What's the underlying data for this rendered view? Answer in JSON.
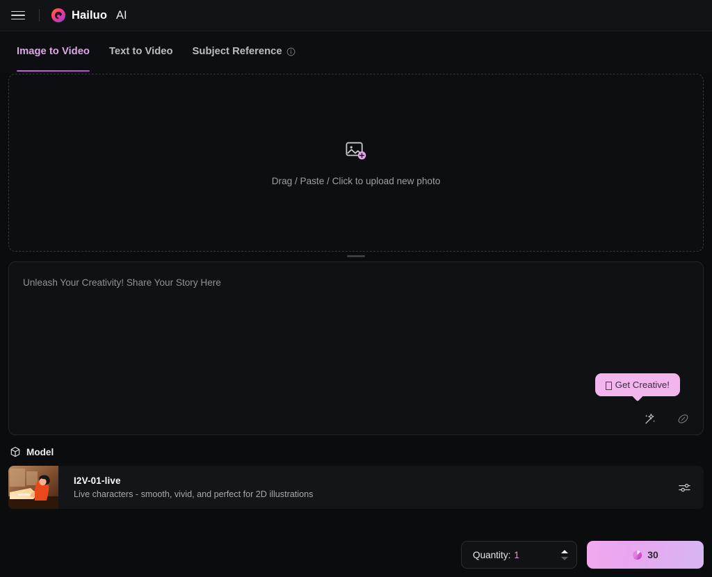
{
  "header": {
    "menu_icon": "hamburger-icon",
    "logo_icon": "hailuo-spiral-logo",
    "brand_name": "Hailuo",
    "brand_suffix": "AI"
  },
  "tabs": [
    {
      "label": "Image to Video",
      "active": true,
      "info": false
    },
    {
      "label": "Text to Video",
      "active": false,
      "info": false
    },
    {
      "label": "Subject Reference",
      "active": false,
      "info": true,
      "info_icon": "info-circle-icon"
    }
  ],
  "upload": {
    "icon": "image-add-icon",
    "text": "Drag / Paste / Click to upload new photo"
  },
  "resize_handle": {
    "name": "panel-resize-handle"
  },
  "prompt": {
    "placeholder": "Unleash Your Creativity! Share Your Story Here",
    "value": "",
    "tooltip_text": "Get Creative!",
    "tooltip_glyph": "missing-glyph-box",
    "tools": [
      {
        "name": "magic-wand-icon",
        "title": "Get Creative!"
      },
      {
        "name": "eraser-icon",
        "title": "Clear"
      }
    ]
  },
  "model_section": {
    "icon": "cube-icon",
    "label": "Model",
    "card": {
      "thumbnail": "artist-drawing-illustration",
      "name": "I2V-01-live",
      "description": "Live characters - smooth, vivid, and perfect for 2D illustrations",
      "settings_icon": "sliders-icon"
    }
  },
  "footer": {
    "quantity_label": "Quantity:",
    "quantity_value": "1",
    "stepper_up": "caret-up-icon",
    "stepper_down": "caret-down-icon",
    "generate_credits": "30",
    "credit_icon": "credit-orb-icon"
  },
  "colors": {
    "page_bg": "#0b0c0e",
    "header_bg": "#121316",
    "accent_pink": "#dda6e6",
    "accent_underline": "#c961d6",
    "tooltip_bg": "#f3b5ee",
    "button_gradient_start": "#f2a8ee",
    "button_gradient_end": "#d7b6f2",
    "quantity_value": "#e98fe0"
  }
}
